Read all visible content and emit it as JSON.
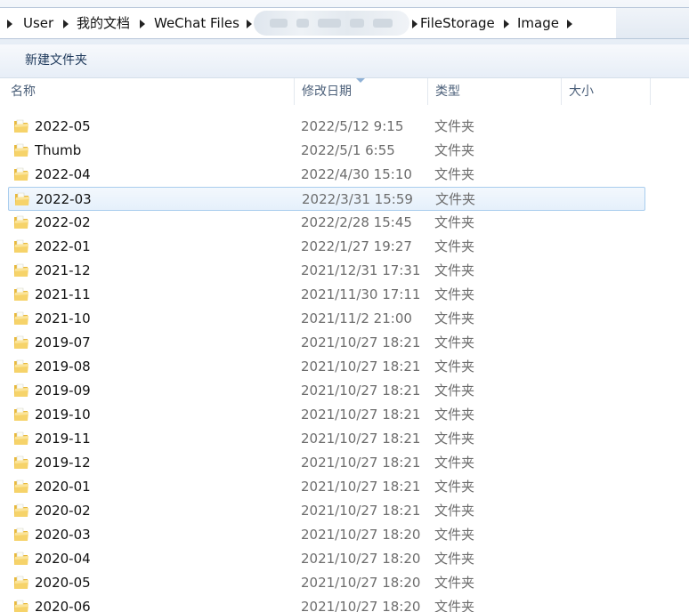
{
  "breadcrumb": {
    "items": [
      {
        "label": "User"
      },
      {
        "label": "我的文档"
      },
      {
        "label": "WeChat Files"
      },
      {
        "label": ""
      },
      {
        "label": "FileStorage"
      },
      {
        "label": "Image"
      }
    ]
  },
  "toolbar": {
    "new_folder_label": "新建文件夹"
  },
  "columns": {
    "name": "名称",
    "modified": "修改日期",
    "type": "类型",
    "size": "大小"
  },
  "rows": [
    {
      "name": "2022-05",
      "date": "2022/5/12 9:15",
      "type": "文件夹"
    },
    {
      "name": "Thumb",
      "date": "2022/5/1 6:55",
      "type": "文件夹"
    },
    {
      "name": "2022-04",
      "date": "2022/4/30 15:10",
      "type": "文件夹"
    },
    {
      "name": "2022-03",
      "date": "2022/3/31 15:59",
      "type": "文件夹",
      "selected": true
    },
    {
      "name": "2022-02",
      "date": "2022/2/28 15:45",
      "type": "文件夹"
    },
    {
      "name": "2022-01",
      "date": "2022/1/27 19:27",
      "type": "文件夹"
    },
    {
      "name": "2021-12",
      "date": "2021/12/31 17:31",
      "type": "文件夹"
    },
    {
      "name": "2021-11",
      "date": "2021/11/30 17:11",
      "type": "文件夹"
    },
    {
      "name": "2021-10",
      "date": "2021/11/2 21:00",
      "type": "文件夹"
    },
    {
      "name": "2019-07",
      "date": "2021/10/27 18:21",
      "type": "文件夹"
    },
    {
      "name": "2019-08",
      "date": "2021/10/27 18:21",
      "type": "文件夹"
    },
    {
      "name": "2019-09",
      "date": "2021/10/27 18:21",
      "type": "文件夹"
    },
    {
      "name": "2019-10",
      "date": "2021/10/27 18:21",
      "type": "文件夹"
    },
    {
      "name": "2019-11",
      "date": "2021/10/27 18:21",
      "type": "文件夹"
    },
    {
      "name": "2019-12",
      "date": "2021/10/27 18:21",
      "type": "文件夹"
    },
    {
      "name": "2020-01",
      "date": "2021/10/27 18:21",
      "type": "文件夹"
    },
    {
      "name": "2020-02",
      "date": "2021/10/27 18:21",
      "type": "文件夹"
    },
    {
      "name": "2020-03",
      "date": "2021/10/27 18:20",
      "type": "文件夹"
    },
    {
      "name": "2020-04",
      "date": "2021/10/27 18:20",
      "type": "文件夹"
    },
    {
      "name": "2020-05",
      "date": "2021/10/27 18:20",
      "type": "文件夹"
    },
    {
      "name": "2020-06",
      "date": "2021/10/27 18:20",
      "type": "文件夹"
    }
  ]
}
